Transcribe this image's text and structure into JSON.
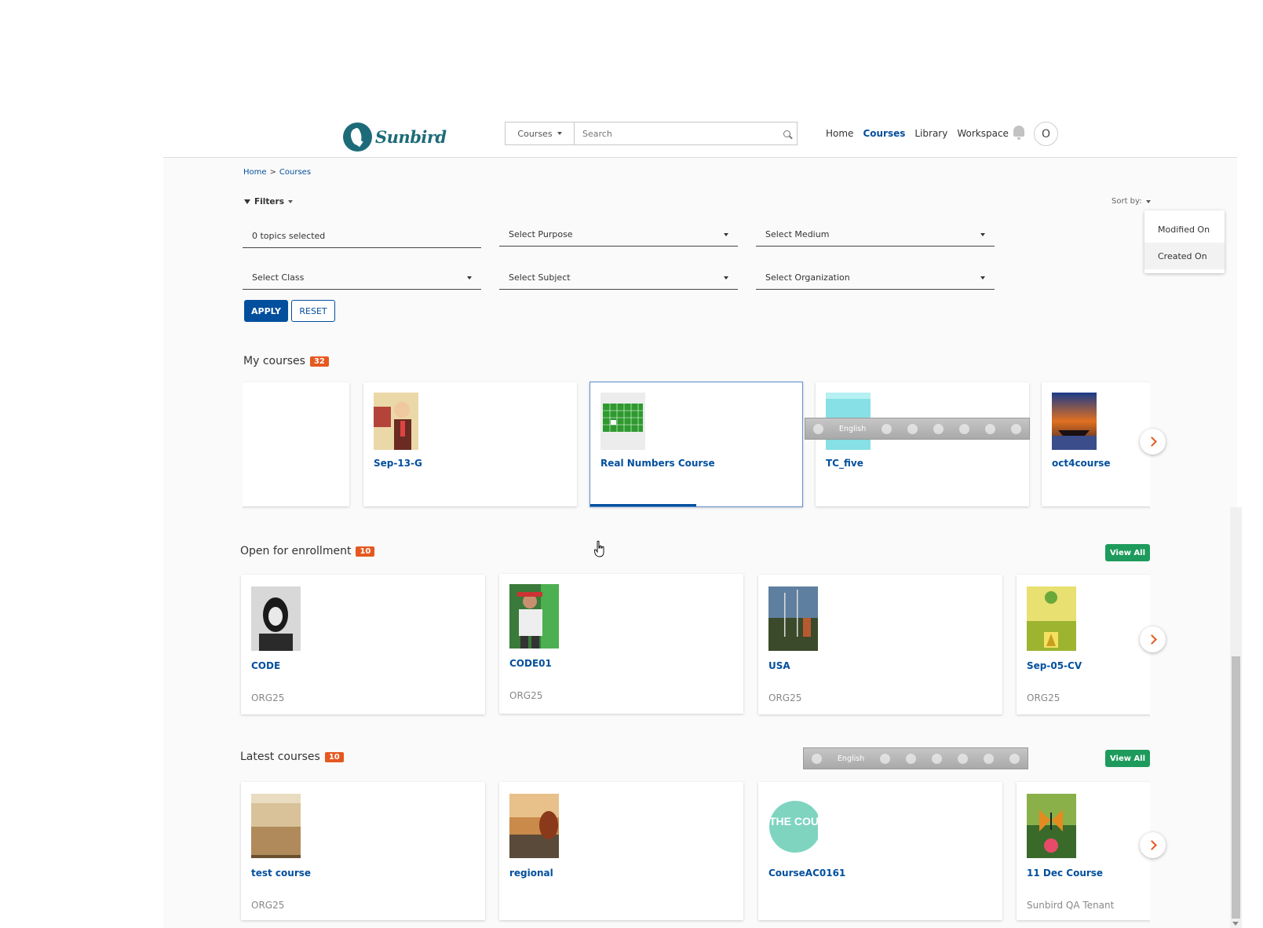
{
  "header": {
    "logo_text": "Sunbird",
    "search": {
      "category": "Courses",
      "placeholder": "Search"
    },
    "nav": [
      "Home",
      "Courses",
      "Library",
      "Workspace"
    ],
    "active_nav": "Courses",
    "avatar_initial": "O"
  },
  "breadcrumb": {
    "home": "Home",
    "sep": ">",
    "current": "Courses"
  },
  "filters": {
    "toggle_label": "Filters",
    "sort_label": "Sort by:",
    "sort_options": [
      "Modified On",
      "Created On"
    ],
    "fields": {
      "topics": "0 topics selected",
      "purpose": "Select Purpose",
      "medium": "Select Medium",
      "class": "Select Class",
      "subject": "Select Subject",
      "organization": "Select Organization"
    },
    "apply_label": "APPLY",
    "reset_label": "RESET"
  },
  "my_courses": {
    "title": "My courses",
    "count": "32",
    "cards": [
      {
        "title": "Sep-13-G"
      },
      {
        "title": "Real Numbers Course",
        "progress": 0.5
      },
      {
        "title": "TC_five"
      },
      {
        "title": "oct4course"
      }
    ]
  },
  "open_enrollment": {
    "title": "Open for enrollment",
    "count": "10",
    "view_all": "View All",
    "cards": [
      {
        "title": "CODE",
        "org": "ORG25"
      },
      {
        "title": "CODE01",
        "org": "ORG25"
      },
      {
        "title": "USA",
        "org": "ORG25"
      },
      {
        "title": "Sep-05-CV",
        "org": "ORG25"
      }
    ]
  },
  "latest_courses": {
    "title": "Latest courses",
    "count": "10",
    "view_all": "View All",
    "cards": [
      {
        "title": "test course",
        "org": "ORG25"
      },
      {
        "title": "regional",
        "org": ""
      },
      {
        "title": "CourseAC0161",
        "org": ""
      },
      {
        "title": "11 Dec Course",
        "org": "Sunbird QA Tenant"
      }
    ]
  },
  "ime_toolbar": {
    "language": "English"
  },
  "thumb_text": {
    "course_logo": "THE COURSE"
  }
}
